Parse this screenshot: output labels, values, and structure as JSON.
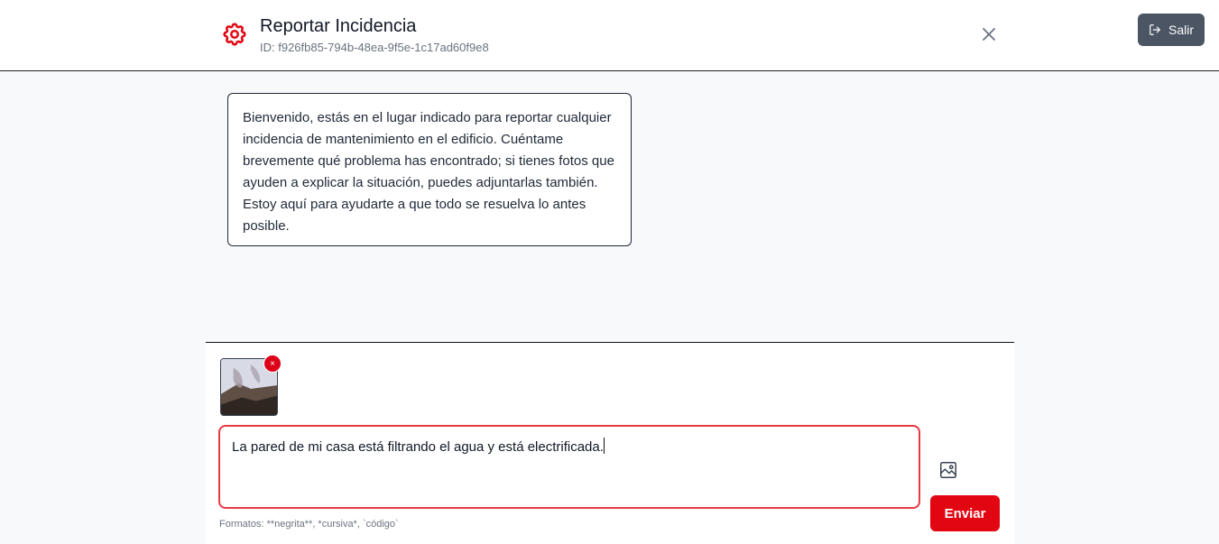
{
  "header": {
    "title": "Reportar Incidencia",
    "id_label": "ID: f926fb85-794b-48ea-9f5e-1c17ad60f9e8",
    "logout_label": "Salir",
    "brand_color": "#e20613"
  },
  "chat": {
    "welcome_message": "Bienvenido, estás en el lugar indicado para reportar cualquier incidencia de mantenimiento en el edificio. Cuéntame brevemente qué problema has encontrado; si tienes fotos que ayuden a explicar la situación, puedes adjuntarlas también. Estoy aquí para ayudarte a que todo se resuelva lo antes posible."
  },
  "composer": {
    "attachment_remove_label": "×",
    "input_value": "La pared de mi casa está filtrando el agua y está electrificada.",
    "send_label": "Enviar",
    "format_hint": "Formatos: **negrita**, *cursiva*, `código`"
  }
}
